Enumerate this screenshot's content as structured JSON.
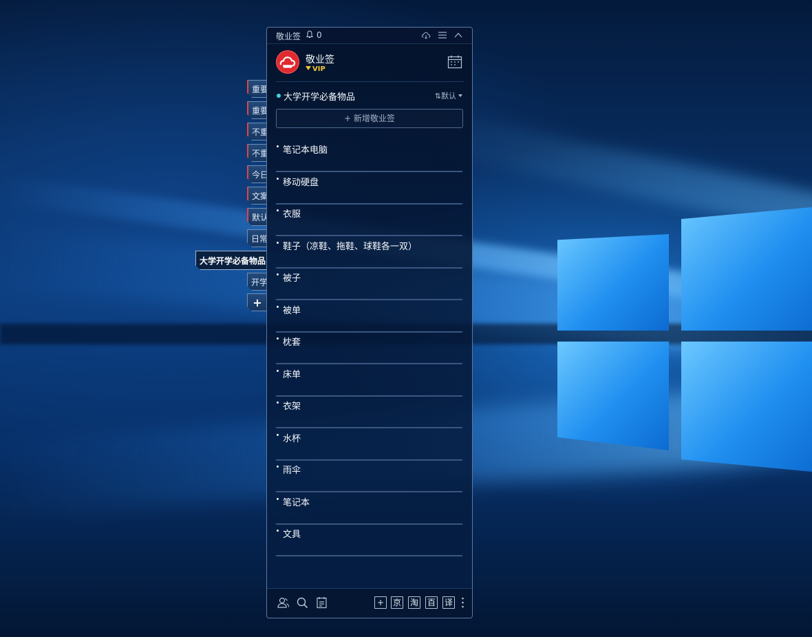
{
  "app": {
    "title": "敬业签",
    "notification_count": "0"
  },
  "user": {
    "name": "敬业签",
    "badge": "VIP"
  },
  "side_tabs": [
    {
      "label": "重要"
    },
    {
      "label": "重要"
    },
    {
      "label": "不重"
    },
    {
      "label": "不重"
    },
    {
      "label": "今日"
    },
    {
      "label": "文案"
    },
    {
      "label": "默认"
    },
    {
      "label": "日常"
    },
    {
      "label": "大学开学必备物品"
    },
    {
      "label": "开学"
    },
    {
      "label": "+"
    }
  ],
  "list": {
    "title": "大学开学必备物品",
    "sort_label": "默认",
    "sort_icon": "⇅",
    "add_button": "+ 新增敬业签",
    "items": [
      {
        "text": "笔记本电脑"
      },
      {
        "text": "移动硬盘"
      },
      {
        "text": "衣服"
      },
      {
        "text": "鞋子（凉鞋、拖鞋、球鞋各一双）"
      },
      {
        "text": "被子"
      },
      {
        "text": "被单"
      },
      {
        "text": "枕套"
      },
      {
        "text": "床单"
      },
      {
        "text": "衣架"
      },
      {
        "text": "水杯"
      },
      {
        "text": "雨伞"
      },
      {
        "text": "笔记本"
      },
      {
        "text": "文具"
      }
    ]
  },
  "bottom_bar": {
    "buttons": [
      "+",
      "京",
      "淘",
      "百",
      "译"
    ]
  },
  "colors": {
    "accent_dot": "#46d2e0",
    "avatar_red": "#e12a2f",
    "vip_gold": "#f3c533",
    "panel_border": "#5b7aa5"
  },
  "icons": [
    "bell-icon",
    "cloud-sync-icon",
    "menu-icon",
    "collapse-icon",
    "calendar-icon",
    "contacts-icon",
    "search-icon",
    "notes-icon",
    "more-icon"
  ]
}
